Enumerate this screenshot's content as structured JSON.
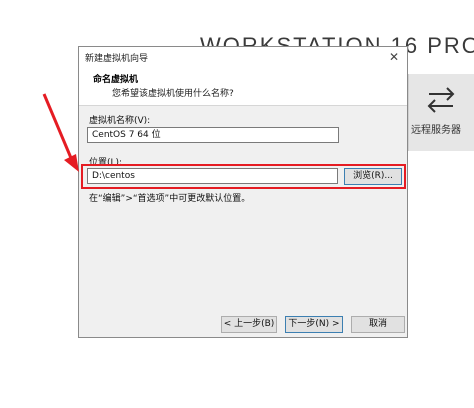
{
  "background": {
    "product_title": "WORKSTATION 16 PRO",
    "trademark": "™",
    "remote_server_label": "远程服务器",
    "remote_icon": "swap-arrows-icon"
  },
  "dialog": {
    "title": "新建虚拟机向导",
    "close_glyph": "✕",
    "heading": "命名虚拟机",
    "subheading": "您希望该虚拟机使用什么名称?",
    "vm_name_label": "虚拟机名称(V):",
    "vm_name_value": "CentOS 7 64 位",
    "location_label": "位置(L):",
    "location_value": "D:\\centos",
    "browse_label": "浏览(R)...",
    "hint": "在“编辑”>“首选项”中可更改默认位置。",
    "back_label": "< 上一步(B)",
    "next_label": "下一步(N) >",
    "cancel_label": "取消"
  },
  "colors": {
    "highlight": "#e51c23",
    "arrow": "#e51c23"
  }
}
